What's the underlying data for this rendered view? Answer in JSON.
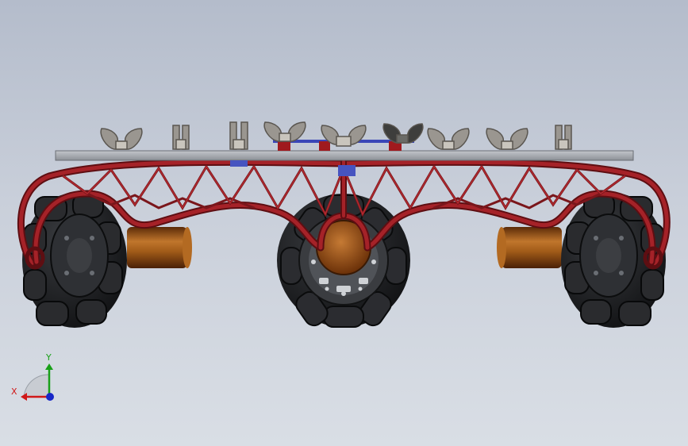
{
  "triad": {
    "x_label": "X",
    "y_label": "Y"
  },
  "colors": {
    "background_top": "#b4bccb",
    "background_bottom": "#d9dee5",
    "frame_red": "#8e1a1e",
    "plate_gray": "#a9adb3",
    "tire_black": "#1e1f22",
    "motor_bronze": "#8a4a14",
    "axis_x": "#d01818",
    "axis_y": "#18a018",
    "axis_z": "#1828c8"
  }
}
